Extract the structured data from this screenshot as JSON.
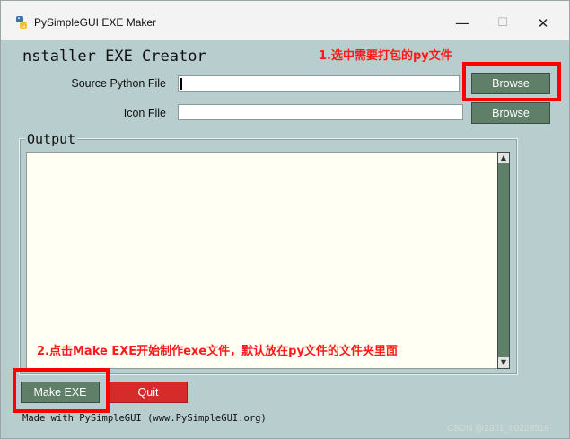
{
  "window": {
    "title": "PySimpleGUI EXE Maker",
    "minimize_symbol": "—",
    "maximize_symbol": "☐",
    "close_symbol": "✕"
  },
  "main": {
    "heading": "nstaller EXE Creator",
    "source_label": "Source Python File",
    "source_value": "",
    "icon_label": "Icon File",
    "icon_value": "",
    "browse_label_1": "Browse",
    "browse_label_2": "Browse",
    "output_label": "Output",
    "output_text": "",
    "make_exe_label": "Make EXE",
    "quit_label": "Quit",
    "footer_text": "Made with PySimpleGUI (www.PySimpleGUI.org)"
  },
  "annotations": {
    "note_1": "1.选中需要打包的py文件",
    "note_2": "2.点击Make EXE开始制作exe文件，默认放在py文件的文件夹里面"
  },
  "watermark": "CSDN @2301_80226516",
  "colors": {
    "background": "#b8cdcd",
    "button_green": "#5f7f68",
    "button_red": "#d62b2b",
    "highlight": "#ff0000"
  },
  "icons": {
    "app": "python-logo-icon",
    "scroll_up": "arrow-up-icon",
    "scroll_down": "arrow-down-icon"
  }
}
